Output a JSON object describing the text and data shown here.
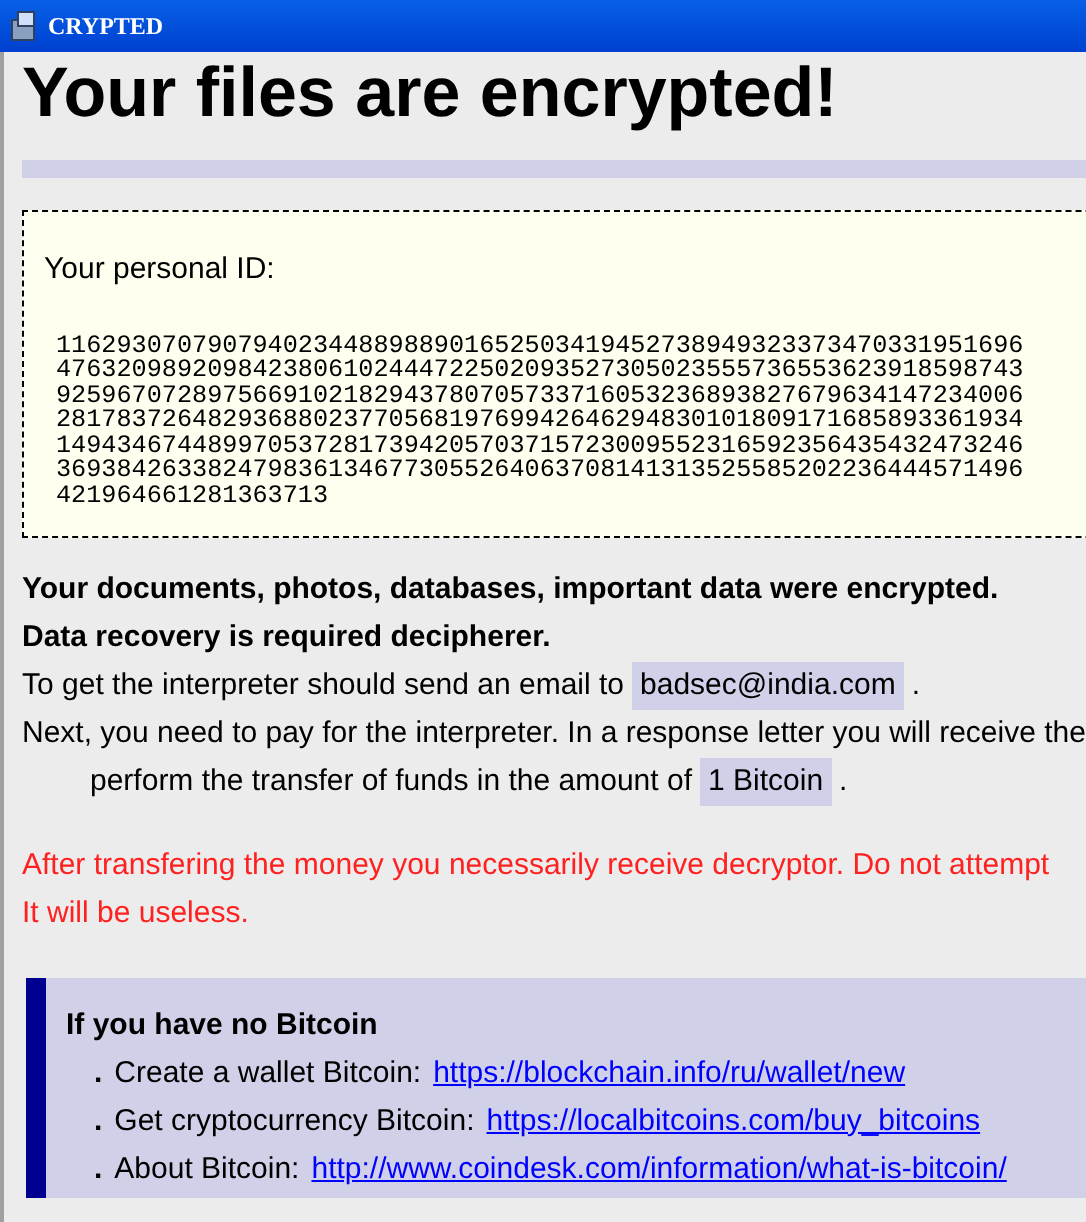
{
  "window": {
    "title": "CRYPTED"
  },
  "heading": "Your files are encrypted!",
  "personal_id": {
    "label": "Your personal ID:",
    "lines": [
      "1162930707907940234488988901652503419452738949323373470331951696",
      "4763209892098423806102444722502093527305023555736553623918598743",
      "9259670728975669102182943780705733716053236893827679634147234006",
      "2817837264829368802377056819769942646294830101809171685893361934",
      "1494346744899705372817394205703715723009552316592356435432473246",
      "3693842633824798361346773055264063708141313525585202236444571496",
      "421964661281363713"
    ]
  },
  "notice": [
    {
      "kind": "bold",
      "text": "Your documents, photos, databases, important data were encrypted."
    },
    {
      "kind": "bold",
      "text": "Data recovery is required decipherer."
    },
    {
      "kind": "highlight",
      "before": "To get the interpreter should send an email to",
      "value": "badsec@india.com",
      "after": "."
    },
    {
      "kind": "plain",
      "text": "Next, you need to pay for the interpreter. In a response letter you will receive the"
    },
    {
      "kind": "indent_highlight",
      "before": "perform the transfer of funds in the amount of",
      "value": "1 Bitcoin",
      "after": "."
    }
  ],
  "warning": [
    "After transfering the money you necessarily receive decryptor. Do not attempt",
    "It will be useless."
  ],
  "bitcoin_help": {
    "title": "If you have no Bitcoin",
    "items": [
      {
        "bullet": ".",
        "text": "Create a wallet Bitcoin:",
        "link": "https://blockchain.info/ru/wallet/new"
      },
      {
        "bullet": ".",
        "text": "Get cryptocurrency Bitcoin:",
        "link": "https://localbitcoins.com/buy_bitcoins"
      },
      {
        "bullet": ".",
        "text": "About Bitcoin:",
        "link": "http://www.coindesk.com/information/what-is-bitcoin/"
      }
    ]
  }
}
